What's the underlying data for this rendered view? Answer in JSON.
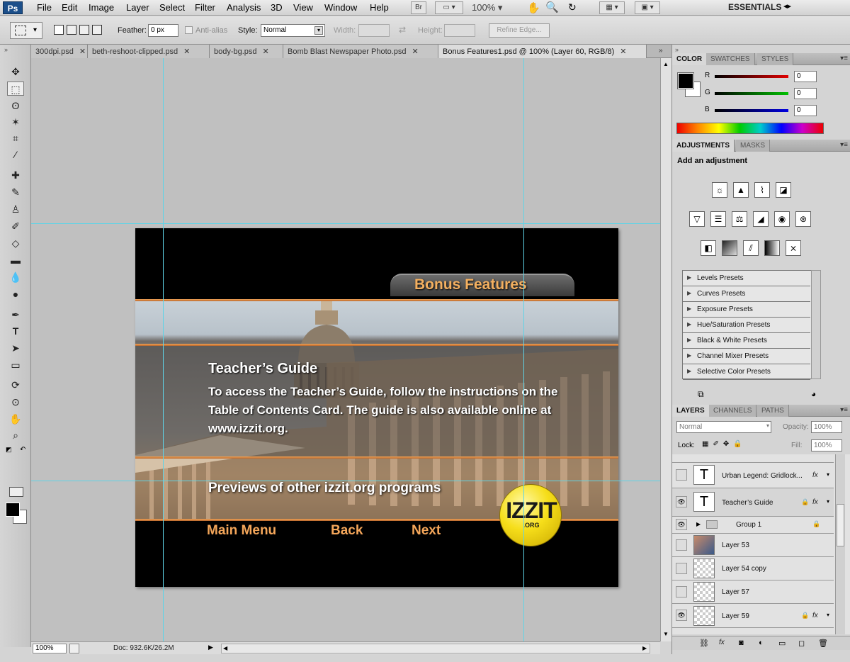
{
  "app": {
    "logo": "Ps",
    "workspace": "ESSENTIALS",
    "zoom": "100%"
  },
  "menu": [
    "File",
    "Edit",
    "Image",
    "Layer",
    "Select",
    "Filter",
    "Analysis",
    "3D",
    "View",
    "Window",
    "Help"
  ],
  "bridge_label": "Br",
  "options": {
    "feather_label": "Feather:",
    "feather_value": "0 px",
    "antialias_label": "Anti-alias",
    "style_label": "Style:",
    "style_value": "Normal",
    "width_label": "Width:",
    "height_label": "Height:",
    "refine_label": "Refine Edge..."
  },
  "tabs": [
    {
      "label": "300dpi.psd",
      "close": "✕"
    },
    {
      "label": "beth-reshoot-clipped.psd",
      "close": "✕"
    },
    {
      "label": "body-bg.psd",
      "close": "✕"
    },
    {
      "label": "Bomb Blast Newspaper Photo.psd",
      "close": "✕"
    },
    {
      "label": "Bonus Features1.psd @ 100% (Layer 60, RGB/8)",
      "close": "✕"
    }
  ],
  "document": {
    "title": "Bonus Features",
    "guide_title": "Teacher’s Guide",
    "guide_body": "To access the Teacher’s Guide, follow the instructions on the Table of Contents Card.  The guide is also available online at www.izzit.org.",
    "previews": "Previews of other izzit.org programs",
    "nav": [
      "Main Menu",
      "Back",
      "Next"
    ],
    "logo_main": "IZZIT",
    "logo_sub": ".ORG"
  },
  "status": {
    "zoom": "100%",
    "doc": "Doc: 932.6K/26.2M"
  },
  "color_panel": {
    "tabs": [
      "COLOR",
      "SWATCHES",
      "STYLES"
    ],
    "channels": [
      {
        "label": "R",
        "value": "0",
        "color": "#e00000"
      },
      {
        "label": "G",
        "value": "0",
        "color": "#00c000"
      },
      {
        "label": "B",
        "value": "0",
        "color": "#0000e0"
      }
    ]
  },
  "adjustments": {
    "tabs": [
      "ADJUSTMENTS",
      "MASKS"
    ],
    "heading": "Add an adjustment",
    "presets": [
      "Levels Presets",
      "Curves Presets",
      "Exposure Presets",
      "Hue/Saturation Presets",
      "Black & White Presets",
      "Channel Mixer Presets",
      "Selective Color Presets"
    ]
  },
  "layers_panel": {
    "tabs": [
      "LAYERS",
      "CHANNELS",
      "PATHS"
    ],
    "blend": "Normal",
    "opacity_label": "Opacity:",
    "opacity": "100%",
    "lock_label": "Lock:",
    "fill_label": "Fill:",
    "fill": "100%",
    "layers": [
      {
        "name": "Urban Legend: Gridlock...",
        "type": "text",
        "visible": false,
        "fx": true,
        "locked": false
      },
      {
        "name": "Teacher’s Guide",
        "type": "text",
        "visible": true,
        "fx": true,
        "locked": true
      },
      {
        "name": "Group 1",
        "type": "group",
        "visible": true,
        "fx": false,
        "locked": true
      },
      {
        "name": "Layer 53",
        "type": "photo",
        "visible": false,
        "fx": false,
        "locked": false
      },
      {
        "name": "Layer 54 copy",
        "type": "empty",
        "visible": false,
        "fx": false,
        "locked": false
      },
      {
        "name": "Layer 57",
        "type": "empty",
        "visible": false,
        "fx": false,
        "locked": false
      },
      {
        "name": "Layer 59",
        "type": "empty",
        "visible": true,
        "fx": true,
        "locked": true
      }
    ]
  },
  "glyphs": {
    "fx": "fx",
    "lock": "🔒",
    "eye": "👁",
    "text_layer": "T",
    "panel_menu": "▾≡",
    "expand": "▶",
    "dropdown": "▾"
  }
}
